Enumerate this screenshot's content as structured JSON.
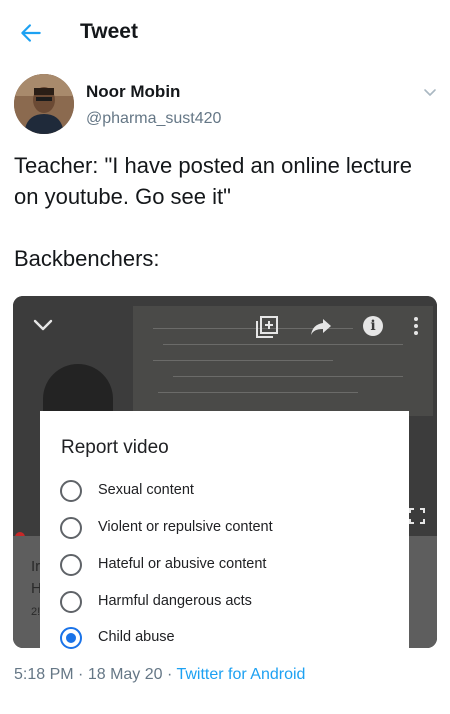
{
  "header": {
    "title": "Tweet",
    "back_icon": "arrow-left-icon"
  },
  "author": {
    "name": "Noor Mobin",
    "handle": "@pharma_sust420"
  },
  "tweet": {
    "text": "Teacher: \"I have posted an online lecture on youtube. Go see it\"\n\nBackbenchers:"
  },
  "video": {
    "icons": [
      "chevron-down-icon",
      "add-to-queue-icon",
      "share-icon",
      "info-icon",
      "more-vert-icon",
      "fullscreen-icon"
    ]
  },
  "report_dialog": {
    "title": "Report video",
    "options": [
      {
        "label": "Sexual content",
        "selected": false
      },
      {
        "label": "Violent or repulsive content",
        "selected": false
      },
      {
        "label": "Hateful or abusive content",
        "selected": false
      },
      {
        "label": "Harmful dangerous acts",
        "selected": false
      },
      {
        "label": "Child abuse",
        "selected": true
      }
    ]
  },
  "meta": {
    "time": "5:18 PM",
    "date": "18 May 20",
    "source": "Twitter for Android"
  },
  "colors": {
    "twitter_blue": "#1da1f2",
    "radio_selected": "#1a73e8",
    "secondary_text": "#657786"
  }
}
